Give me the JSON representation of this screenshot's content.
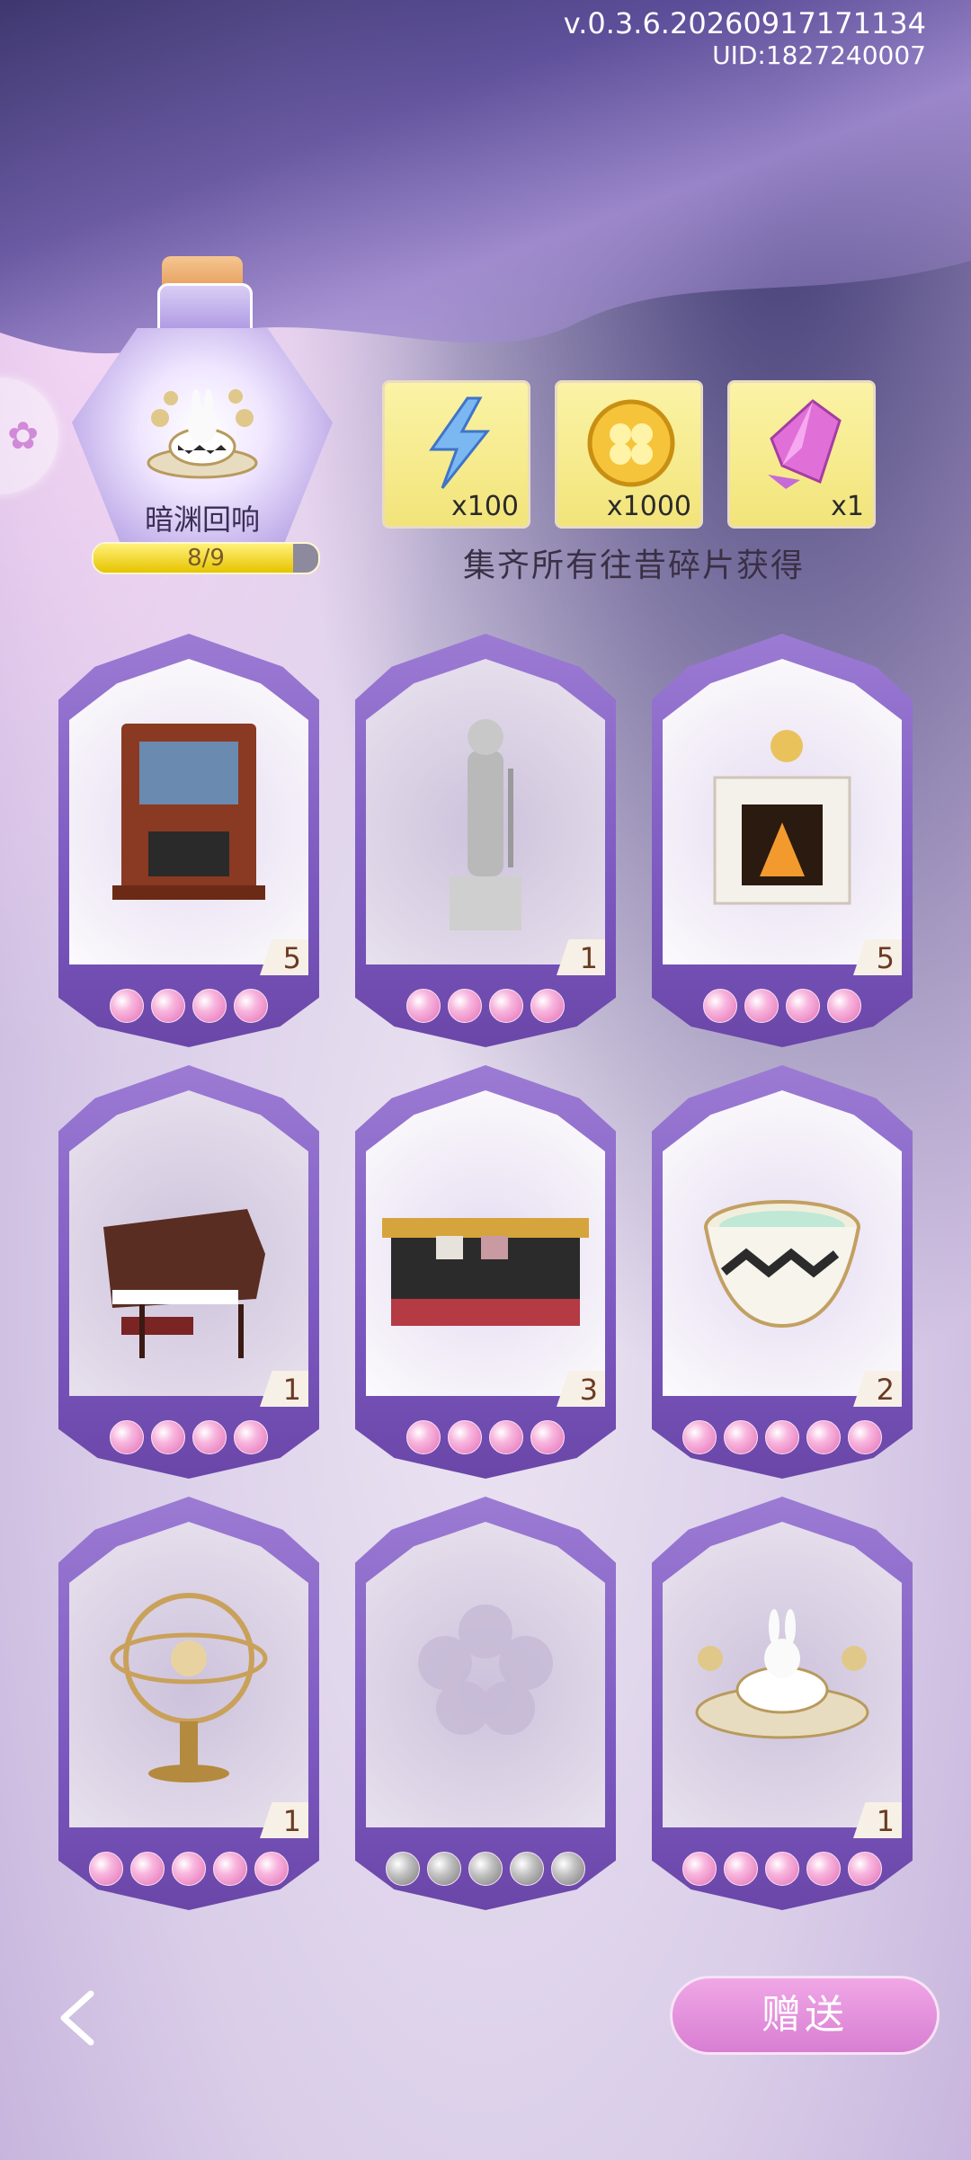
{
  "header": {
    "version": "v.0.3.6.20260917171134",
    "uid": "UID:1827240007"
  },
  "collection": {
    "name": "暗渊回响",
    "progress_text": "8/9",
    "progress_fraction": 0.889
  },
  "rewards": [
    {
      "icon": "lightning-icon",
      "qty": "x100"
    },
    {
      "icon": "clover-coin-icon",
      "qty": "x1000"
    },
    {
      "icon": "pink-crystal-icon",
      "qty": "x1"
    }
  ],
  "reward_caption": "集齐所有往昔碎片获得",
  "cards": [
    {
      "item": "wooden-fireplace",
      "count": "5",
      "pearls": 4,
      "pearl_color": "pink",
      "locked": false
    },
    {
      "item": "knight-statue",
      "count": "1",
      "pearls": 4,
      "pearl_color": "pink",
      "locked": true
    },
    {
      "item": "white-fireplace",
      "count": "5",
      "pearls": 4,
      "pearl_color": "pink",
      "locked": false
    },
    {
      "item": "grand-piano",
      "count": "1",
      "pearls": 4,
      "pearl_color": "pink",
      "locked": true
    },
    {
      "item": "black-sofa",
      "count": "3",
      "pearls": 4,
      "pearl_color": "pink",
      "locked": false
    },
    {
      "item": "teacup",
      "count": "2",
      "pearls": 5,
      "pearl_color": "pink",
      "locked": false
    },
    {
      "item": "armillary-sphere",
      "count": "1",
      "pearls": 5,
      "pearl_color": "pink",
      "locked": true
    },
    {
      "item": "empty-slot",
      "count": "",
      "pearls": 5,
      "pearl_color": "gray",
      "locked": true
    },
    {
      "item": "rabbit-teacup-carousel",
      "count": "1",
      "pearls": 5,
      "pearl_color": "pink",
      "locked": true
    }
  ],
  "footer": {
    "gift_label": "赠送"
  }
}
